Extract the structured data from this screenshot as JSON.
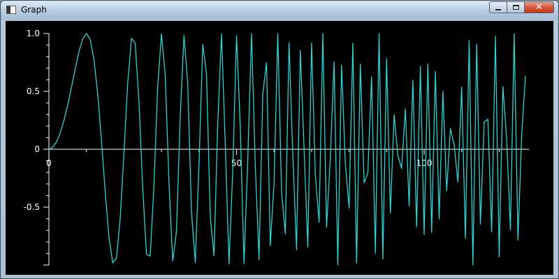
{
  "window": {
    "title": "Graph",
    "controls": {
      "minimize_icon": "minimize-icon",
      "maximize_icon": "maximize-icon",
      "close_icon": "close-icon",
      "close_glyph": "✕"
    }
  },
  "chart_data": {
    "type": "line",
    "title": "",
    "xlabel": "",
    "ylabel": "",
    "xlim": [
      0,
      127
    ],
    "ylim": [
      -1.0,
      1.0
    ],
    "x_ticks": [
      0,
      50,
      100
    ],
    "x_tick_labels": [
      "0",
      "50",
      "100"
    ],
    "y_ticks": [
      1.0,
      0.5,
      0,
      -0.5
    ],
    "y_tick_labels": [
      "1.0",
      "0.5",
      "0",
      "-0.5"
    ],
    "grid": false,
    "colors": {
      "background": "#000000",
      "axes": "#ffffff",
      "line": "#2fd3d3"
    },
    "series": [
      {
        "function": "sin(x^2 / 64)",
        "x_start": 0,
        "x_end": 127,
        "x_step": 1
      }
    ]
  }
}
